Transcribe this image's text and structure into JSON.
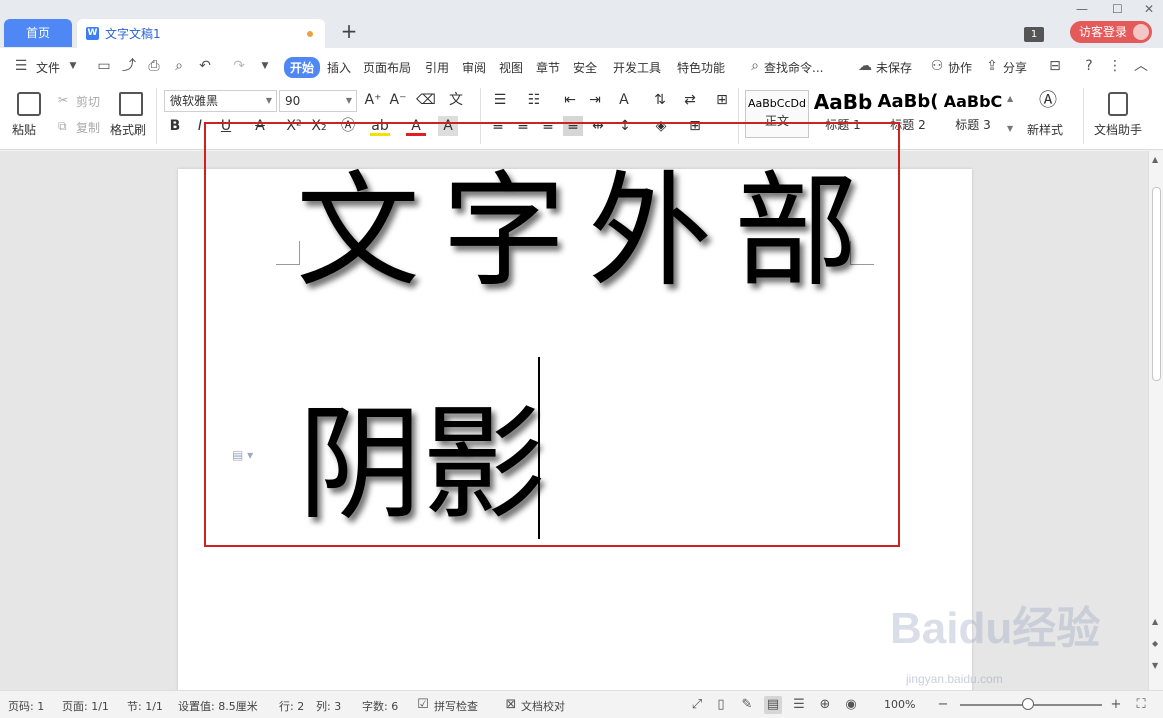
{
  "tabs": {
    "home": "首页",
    "doc": "文字文稿1",
    "add": "+"
  },
  "titlebar": {
    "window_badge": "1",
    "login": "访客登录"
  },
  "menubar": {
    "file": "文件",
    "items": [
      "开始",
      "插入",
      "页面布局",
      "引用",
      "审阅",
      "视图",
      "章节",
      "安全",
      "开发工具",
      "特色功能"
    ],
    "active": "开始",
    "search": "查找命令...",
    "unsaved": "未保存",
    "collab": "协作",
    "share": "分享"
  },
  "ribbon": {
    "paste": "粘贴",
    "cut": "剪切",
    "copy": "复制",
    "format_painter": "格式刷",
    "font_name": "微软雅黑",
    "font_size": "90",
    "styles": [
      {
        "sample": "AaBbCcDd",
        "name": "正文"
      },
      {
        "sample": "AaBb",
        "name": "标题 1"
      },
      {
        "sample": "AaBb(",
        "name": "标题 2"
      },
      {
        "sample": "AaBbC",
        "name": "标题 3"
      }
    ],
    "new_style": "新样式",
    "doc_assistant": "文档助手"
  },
  "document": {
    "line1": "文字外部",
    "line2": "阴影"
  },
  "statusbar": {
    "page_num": "页码: 1",
    "pages": "页面: 1/1",
    "section": "节: 1/1",
    "setting": "设置值: 8.5厘米",
    "row": "行: 2",
    "col": "列: 3",
    "word_count": "字数: 6",
    "spell_check": "拼写检查",
    "proofread": "文档校对",
    "zoom": "100%"
  },
  "watermark": {
    "brand": "Baidu经验",
    "url": "jingyan.baidu.com"
  },
  "colors": {
    "accent": "#4f88f5",
    "selection_border": "#cc2222",
    "login": "#e45a5a"
  }
}
